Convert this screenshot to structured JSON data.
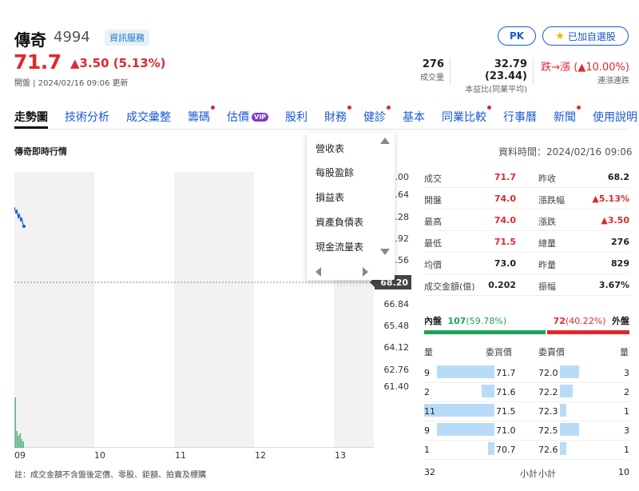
{
  "header": {
    "name": "傳奇",
    "code": "4994",
    "info_badge": "資訊服務",
    "pk_label": "PK",
    "watch_label": "已加自選股",
    "price": "71.7",
    "change": "▲3.50 (5.13%)",
    "status": "開盤 | 2024/02/16 09:06 更新",
    "stats": [
      {
        "value": "276",
        "label": "成交量"
      },
      {
        "value": "32.79 (23.44)",
        "label": "本益比(同業平均)"
      },
      {
        "value": "跌→漲 (▲10.00%)",
        "label": "連漲連跌"
      }
    ]
  },
  "tabs": [
    {
      "label": "走勢圖",
      "active": true,
      "dot": false
    },
    {
      "label": "技術分析",
      "dot": false
    },
    {
      "label": "成交彙整",
      "dot": false
    },
    {
      "label": "籌碼",
      "dot": true
    },
    {
      "label": "估價",
      "vip": "VIP",
      "dot": false
    },
    {
      "label": "股利",
      "dot": false
    },
    {
      "label": "財務",
      "dot": true
    },
    {
      "label": "健診",
      "dot": true
    },
    {
      "label": "基本",
      "dot": false
    },
    {
      "label": "同業比較",
      "dot": true
    },
    {
      "label": "行事曆",
      "dot": false
    },
    {
      "label": "新聞",
      "dot": true
    },
    {
      "label": "使用說明",
      "dot": false
    }
  ],
  "section_title": "傳奇即時行情",
  "data_time": "資料時間：2024/02/16 09:06",
  "dropdown": {
    "items": [
      "營收表",
      "每股盈餘",
      "損益表",
      "資產負債表",
      "現金流量表"
    ]
  },
  "chart": {
    "y_ticks_partial": [
      ".00",
      ".64",
      ".28",
      ".92",
      ".56"
    ],
    "y_ticks": [
      "66.84",
      "65.48",
      "64.12",
      "62.76",
      "61.40"
    ],
    "current_price_tag": "68.20",
    "x_ticks": [
      "09",
      "10",
      "11",
      "12",
      "13"
    ],
    "note": "註：成交金額不含盤後定價、零股、鉅額、拍賣及標購"
  },
  "quote": [
    {
      "l1": "成交",
      "v1": "71.7",
      "c1": "red",
      "l2": "昨收",
      "v2": "68.2",
      "c2": "dark"
    },
    {
      "l1": "開盤",
      "v1": "74.0",
      "c1": "red",
      "l2": "漲跌幅",
      "v2": "▲5.13%",
      "c2": "red"
    },
    {
      "l1": "最高",
      "v1": "74.0",
      "c1": "red",
      "l2": "漲跌",
      "v2": "▲3.50",
      "c2": "red"
    },
    {
      "l1": "最低",
      "v1": "71.5",
      "c1": "red",
      "l2": "總量",
      "v2": "276",
      "c2": "dark"
    },
    {
      "l1": "均價",
      "v1": "73.0",
      "c1": "dark",
      "l2": "昨量",
      "v2": "829",
      "c2": "dark"
    },
    {
      "l1": "成交金額(億)",
      "v1": "0.202",
      "c1": "dark",
      "l2": "振幅",
      "v2": "3.67%",
      "c2": "dark"
    }
  ],
  "bidask": {
    "inner_label": "內盤",
    "inner_value": "107",
    "inner_pct": "(59.78%)",
    "outer_value": "72",
    "outer_pct": "(40.22%)",
    "outer_label": "外盤",
    "inner_fraction": 0.5978
  },
  "orderbook": {
    "headers": [
      "量",
      "委買價",
      "委賣價",
      "量"
    ],
    "rows": [
      {
        "bid_qty": "9",
        "bid": "71.7",
        "ask": "72.0",
        "ask_qty": "3",
        "bid_frac": 0.82,
        "ask_frac": 1.0
      },
      {
        "bid_qty": "2",
        "bid": "71.6",
        "ask": "72.2",
        "ask_qty": "2",
        "bid_frac": 0.18,
        "ask_frac": 0.67
      },
      {
        "bid_qty": "11",
        "bid": "71.5",
        "ask": "72.3",
        "ask_qty": "1",
        "bid_frac": 1.0,
        "ask_frac": 0.33
      },
      {
        "bid_qty": "9",
        "bid": "71.0",
        "ask": "72.5",
        "ask_qty": "3",
        "bid_frac": 0.82,
        "ask_frac": 1.0
      },
      {
        "bid_qty": "1",
        "bid": "70.7",
        "ask": "72.6",
        "ask_qty": "1",
        "bid_frac": 0.09,
        "ask_frac": 0.33
      }
    ],
    "footer": {
      "bid_total": "32",
      "bid_label": "小計",
      "ask_label": "小計",
      "ask_total": "10"
    }
  },
  "colors": {
    "up": "#e0282e",
    "down": "#1fa25a",
    "link": "#1a57d6"
  }
}
